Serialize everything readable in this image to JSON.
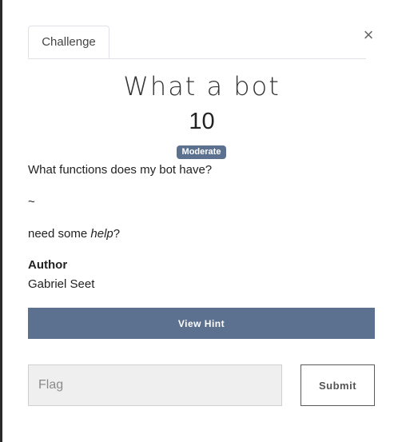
{
  "modal": {
    "tab_label": "Challenge",
    "close_glyph": "×",
    "title": "What a bot",
    "points": "10",
    "difficulty_badge": "Moderate",
    "description": {
      "line1": "What functions does my bot have?",
      "line2": "~",
      "line3_prefix": "need some ",
      "line3_italic": "help",
      "line3_suffix": "?"
    },
    "author_label": "Author",
    "author_name": "Gabriel Seet",
    "hint_button_label": "View Hint",
    "flag_input": {
      "placeholder": "Flag",
      "value": ""
    },
    "submit_label": "Submit"
  },
  "colors": {
    "accent": "#5b718f",
    "input_bg": "#efefef",
    "backdrop_edge": "#2b2b2b"
  }
}
